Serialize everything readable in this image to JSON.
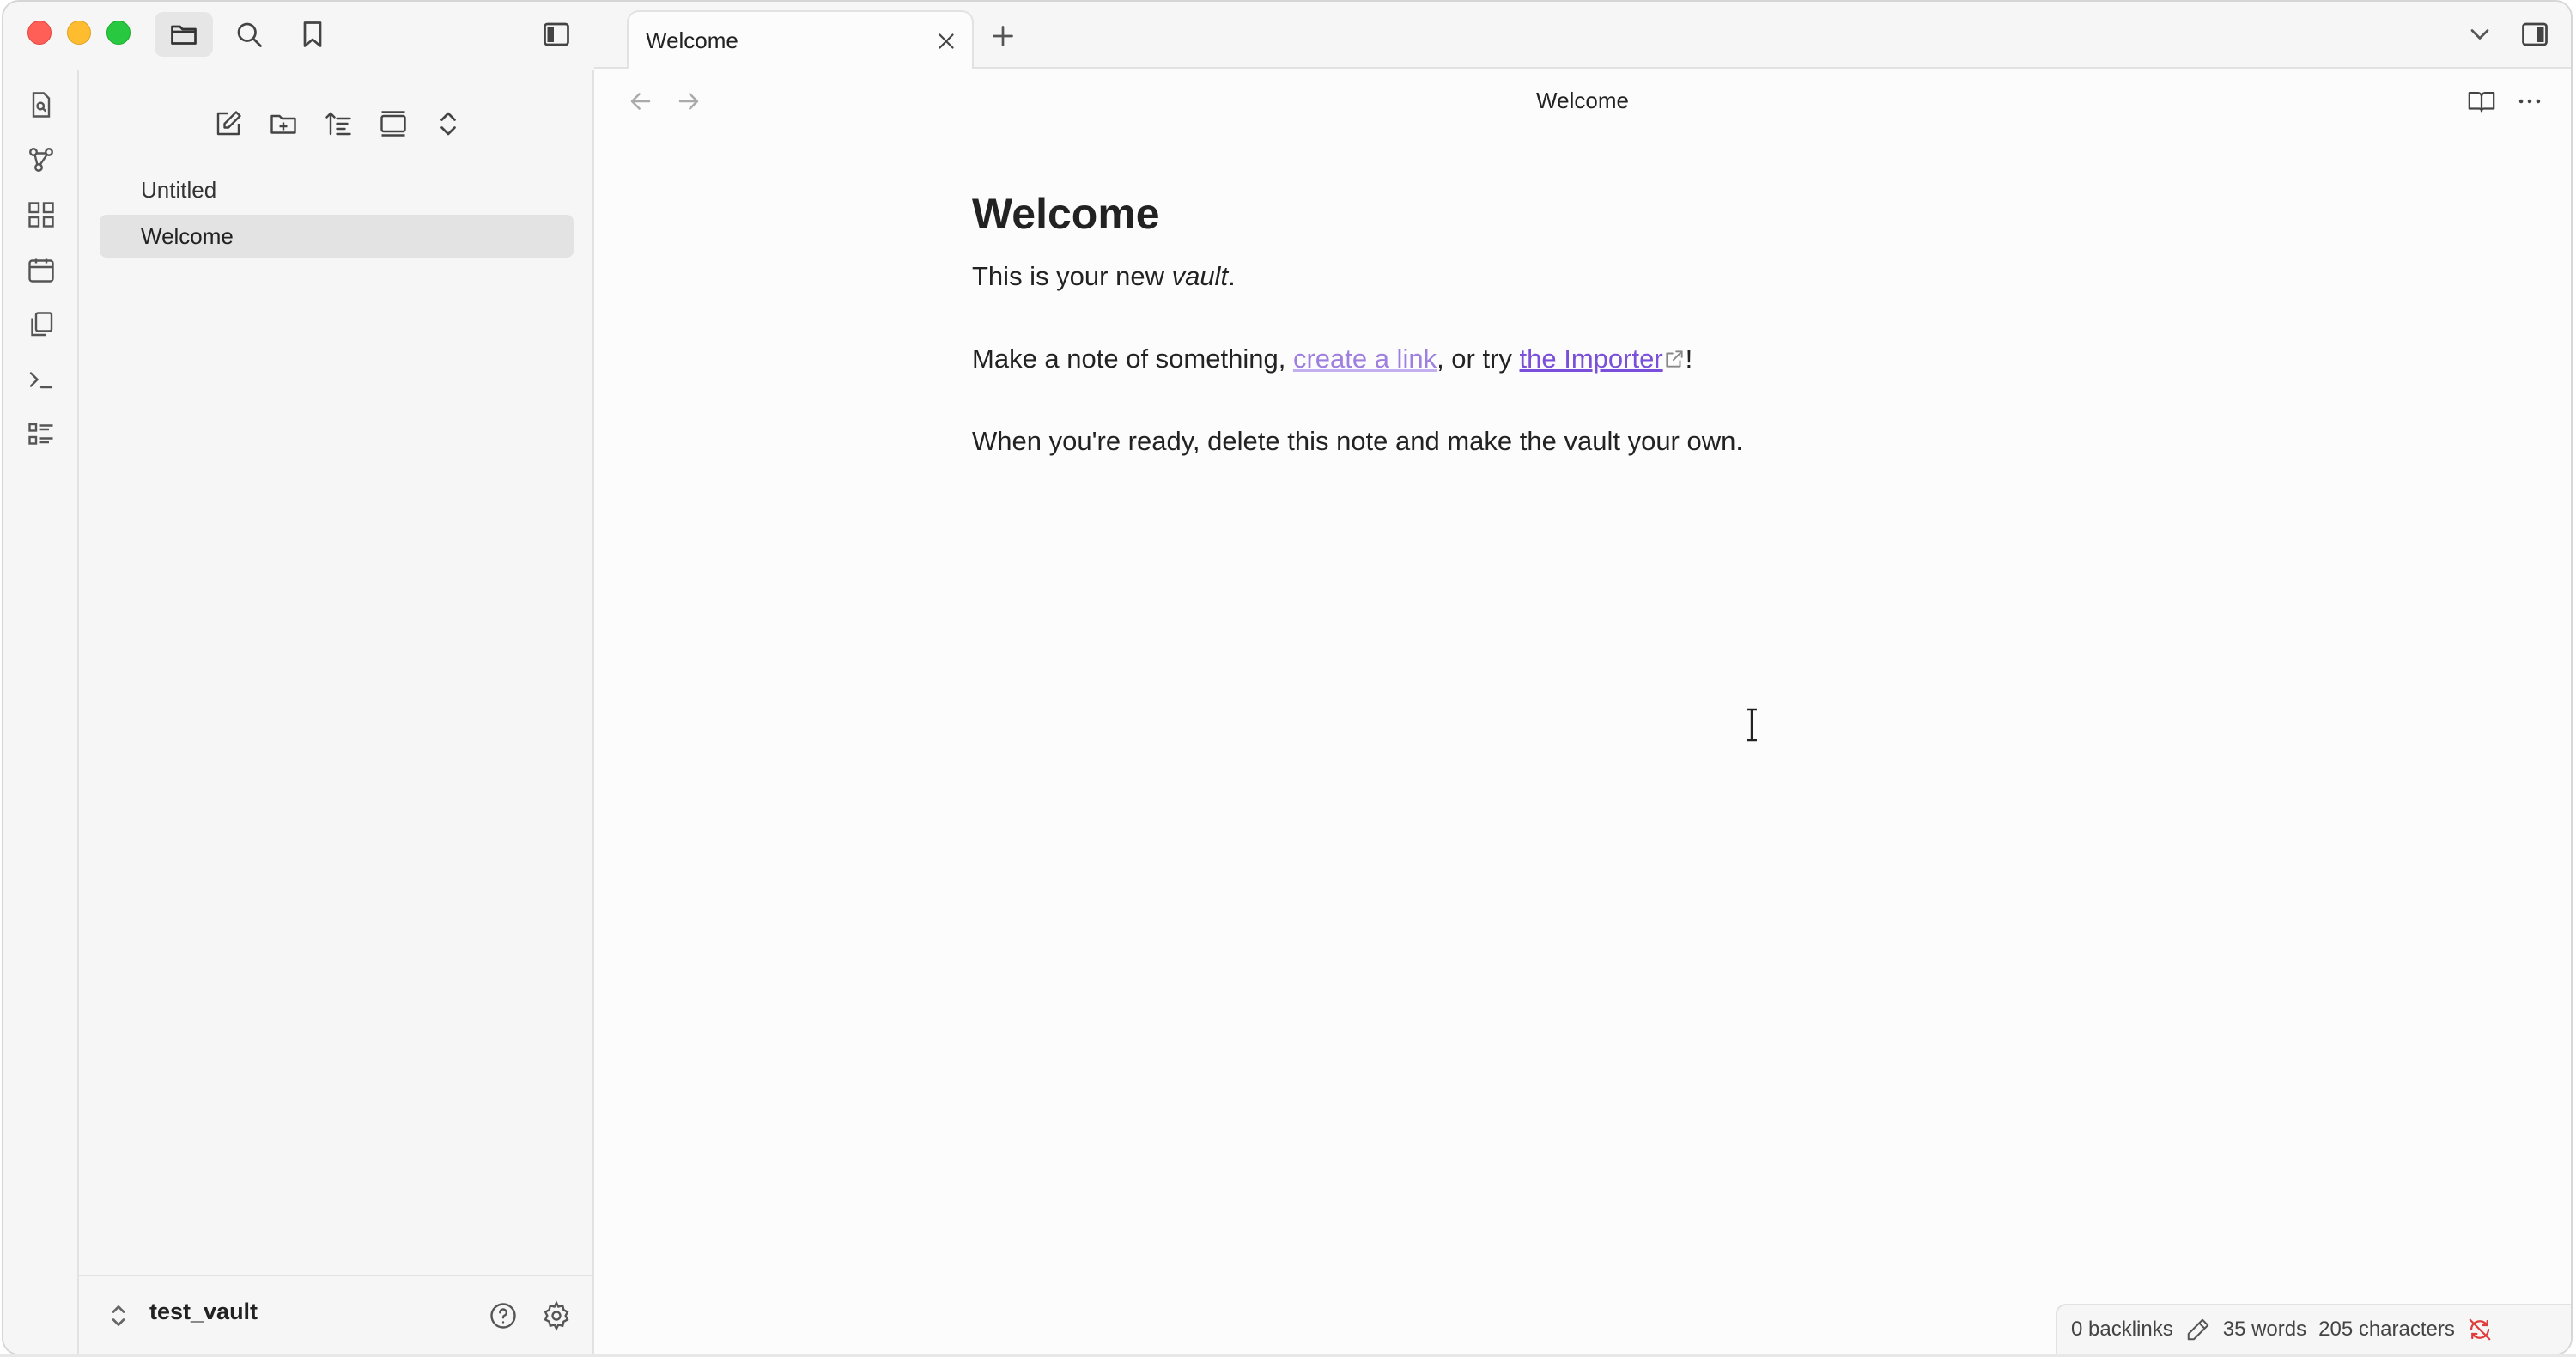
{
  "titlebar": {
    "icons": [
      "folder-icon",
      "search-icon",
      "bookmark-icon",
      "sidebar-toggle-icon"
    ]
  },
  "ribbon": {
    "items": [
      "file-search-icon",
      "graph-icon",
      "canvas-icon",
      "calendar-icon",
      "copy-icon",
      "terminal-icon",
      "list-icon"
    ]
  },
  "sidebar": {
    "toolbar": [
      "new-note-icon",
      "new-folder-icon",
      "sort-icon",
      "collapse-icon",
      "expand-icon"
    ],
    "files": [
      {
        "label": "Untitled"
      },
      {
        "label": "Welcome"
      }
    ],
    "vault_name": "test_vault"
  },
  "tabs": [
    {
      "label": "Welcome"
    }
  ],
  "editor": {
    "view_title": "Welcome",
    "heading": "Welcome",
    "p1_a": "This is your new ",
    "p1_em": "vault",
    "p1_b": ".",
    "p2_a": "Make a note of something, ",
    "p2_link1": "create a link",
    "p2_b": ", or try ",
    "p2_link2": "the Importer",
    "p2_c": "!",
    "p3": "When you're ready, delete this note and make the vault your own."
  },
  "status": {
    "backlinks": "0 backlinks",
    "words": "35 words",
    "characters": "205 characters"
  },
  "colors": {
    "accent": "#7a4fd9",
    "internal_link": "#9e7fe0",
    "sync_error": "#e03c3c"
  }
}
